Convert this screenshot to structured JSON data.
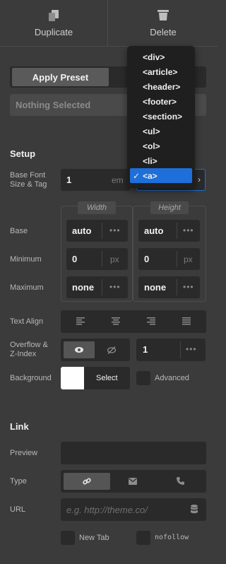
{
  "toolbar": {
    "duplicate_label": "Duplicate",
    "delete_label": "Delete"
  },
  "preset": {
    "apply_label": "Apply Preset",
    "selected_placeholder": "Nothing Selected"
  },
  "setup": {
    "title": "Setup",
    "base_font_label_line1": "Base Font",
    "base_font_label_line2": "Size & Tag",
    "base_font_value": "1",
    "base_font_unit": "em",
    "tag_options": [
      "<div>",
      "<article>",
      "<header>",
      "<footer>",
      "<section>",
      "<ul>",
      "<ol>",
      "<li>",
      "<a>"
    ],
    "tag_selected": "<a>",
    "width_header": "Width",
    "height_header": "Height",
    "rows": [
      {
        "label": "Base",
        "width": "auto",
        "width_unit": "",
        "height": "auto",
        "height_unit": ""
      },
      {
        "label": "Minimum",
        "width": "0",
        "width_unit": "px",
        "height": "0",
        "height_unit": "px"
      },
      {
        "label": "Maximum",
        "width": "none",
        "width_unit": "",
        "height": "none",
        "height_unit": ""
      }
    ],
    "text_align_label": "Text Align",
    "overflow_label_line1": "Overflow &",
    "overflow_label_line2": "Z-Index",
    "z_index_value": "1",
    "background_label": "Background",
    "background_color": "#ffffff",
    "background_select_label": "Select",
    "advanced_label": "Advanced"
  },
  "link": {
    "title": "Link",
    "preview_label": "Preview",
    "type_label": "Type",
    "url_label": "URL",
    "url_placeholder": "e.g. http://theme.co/",
    "new_tab_label": "New Tab",
    "nofollow_label": "nofollow"
  },
  "colors": {
    "panel": "#3b3b3b",
    "field": "#2a2a2a",
    "accent": "#1e6fd9"
  }
}
